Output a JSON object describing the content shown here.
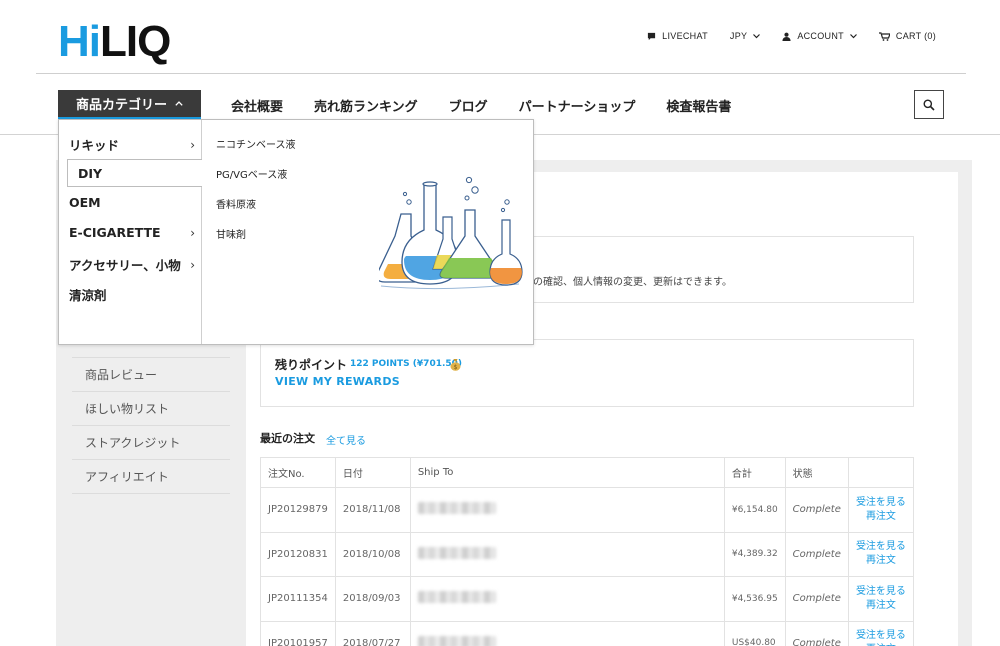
{
  "brand": {
    "logo_hi": "Hi",
    "logo_liq": "LIQ"
  },
  "utility": {
    "livechat": "LIVECHAT",
    "currency": "JPY",
    "account": "ACCOUNT",
    "cart": "CART (0)"
  },
  "nav": {
    "category_button": "商品カテゴリー",
    "items": [
      "会社概要",
      "売れ筋ランキング",
      "ブログ",
      "パートナーショップ",
      "検査報告書"
    ]
  },
  "dropdown": {
    "categories": [
      {
        "label": "リキッド",
        "arrow": "›"
      },
      {
        "label": "DIY",
        "arrow": ""
      },
      {
        "label": "OEM",
        "arrow": ""
      },
      {
        "label": "E-CIGARETTE",
        "arrow": "›"
      },
      {
        "label": "アクセサリー、小物",
        "arrow": "›"
      },
      {
        "label": "清涼剤",
        "arrow": ""
      }
    ],
    "subitems": [
      "ニコチンベース液",
      "PG/VGベース液",
      "香料原液",
      "甘味剤"
    ]
  },
  "account_info": {
    "partial_text": "の確認、個人情報の変更、更新はできます。"
  },
  "points": {
    "label": "残りポイント",
    "value": "122 POINTS (¥701.50)",
    "rewards_link": "VIEW MY REWARDS"
  },
  "sidebar": {
    "items": [
      "商品レビュー",
      "ほしい物リスト",
      "ストアクレジット",
      "アフィリエイト"
    ]
  },
  "orders": {
    "title": "最近の注文",
    "view_all": "全て見る",
    "headers": [
      "注文No.",
      "日付",
      "Ship To",
      "合計",
      "状態",
      ""
    ],
    "view_label": "受注を見る",
    "reorder_label": "再注文",
    "rows": [
      {
        "no": "JP20129879",
        "date": "2018/11/08",
        "total": "¥6,154.80",
        "status": "Complete"
      },
      {
        "no": "JP20120831",
        "date": "2018/10/08",
        "total": "¥4,389.32",
        "status": "Complete"
      },
      {
        "no": "JP20111354",
        "date": "2018/09/03",
        "total": "¥4,536.95",
        "status": "Complete"
      },
      {
        "no": "JP20101957",
        "date": "2018/07/27",
        "total": "US$40.80",
        "status": "Complete"
      }
    ]
  },
  "colors": {
    "accent": "#1a9be0",
    "dark": "#3a3a3a"
  }
}
